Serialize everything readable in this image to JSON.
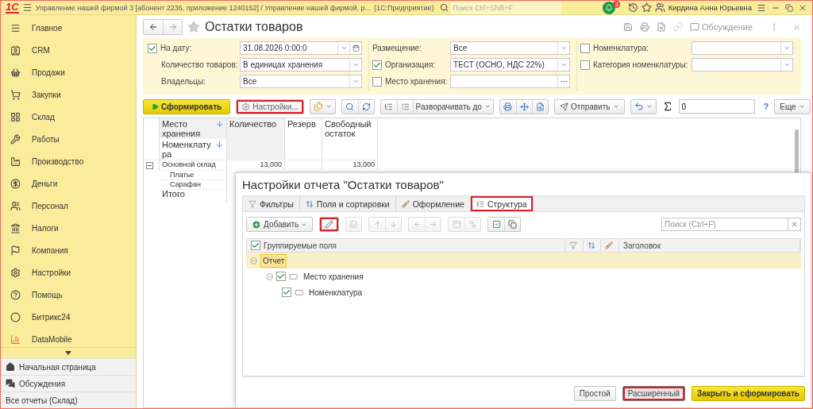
{
  "title_bar": {
    "logo": "1С",
    "title": "Управление нашей фирмой 3 [абонент 2236, приложение 1240152] / Управление нашей фирмой, р...",
    "platform": "(1С:Предприятие)",
    "search": {
      "placeholder": "Поиск Ctrl+Shift+F"
    },
    "notification_count": "3",
    "user": "Кирдина Анна Юрьевна"
  },
  "sidebar": {
    "items": [
      {
        "label": "Главное"
      },
      {
        "label": "CRM"
      },
      {
        "label": "Продажи"
      },
      {
        "label": "Закупки"
      },
      {
        "label": "Склад"
      },
      {
        "label": "Работы"
      },
      {
        "label": "Производство"
      },
      {
        "label": "Деньги"
      },
      {
        "label": "Персонал"
      },
      {
        "label": "Налоги"
      },
      {
        "label": "Компания"
      },
      {
        "label": "Настройки"
      },
      {
        "label": "Помощь"
      },
      {
        "label": "Битрикс24"
      },
      {
        "label": "DataMobile"
      }
    ],
    "footer_items": [
      {
        "label": "Начальная страница"
      },
      {
        "label": "Обсуждения"
      },
      {
        "label": "Все отчеты (Склад)"
      }
    ]
  },
  "form": {
    "title": "Остатки товаров",
    "discussion": "Обсуждение",
    "filter_columns": [
      {
        "fields": [
          {
            "label": "На дату:",
            "checked": true,
            "value": "31.08.2026  0:00:0",
            "kind": "date"
          },
          {
            "label": "Количество товаров:",
            "value": "В единицах хранения",
            "kind": "dropdown"
          },
          {
            "label": "Владельцы:",
            "value": "Все",
            "kind": "dropdown"
          }
        ]
      },
      {
        "fields": [
          {
            "label": "Размещение:",
            "value": "Все",
            "kind": "dropdown"
          },
          {
            "label": "Организация:",
            "checked": true,
            "value": "ТЕСТ (ОСНО, НДС 22%)",
            "kind": "dropdown"
          },
          {
            "label": "Место хранения:",
            "checked": false,
            "kind": "choice"
          }
        ]
      },
      {
        "fields": [
          {
            "label": "Номенклатура:",
            "checked": false,
            "kind": "dropdown"
          },
          {
            "label": "Категория номенклатуры:",
            "checked": false,
            "kind": "dropdown"
          }
        ]
      }
    ],
    "toolbar": {
      "generate": "Сформировать",
      "settings": {
        "label": "Настройки...",
        "highlighted": true
      },
      "expand_to": "Разворачивать до",
      "send": "Отправить",
      "sum_value": "0",
      "help": "?",
      "more": "Еще"
    },
    "report": {
      "group_headings": [
        "Место хранения",
        "Номенклатура"
      ],
      "columns": [
        "Количество",
        "Резерв",
        "Свободный остаток"
      ],
      "rows": [
        {
          "kind": "group",
          "expanded": true,
          "name": "Основной склад",
          "quantity": "13,000",
          "free": "13,000"
        },
        {
          "kind": "item",
          "name": "Платье"
        },
        {
          "kind": "item",
          "name": "Сарафан"
        },
        {
          "kind": "total",
          "name": "Итого"
        }
      ]
    }
  },
  "settings_dialog": {
    "title": "Настройки отчета \"Остатки товаров\"",
    "tabs": [
      {
        "label": "Фильтры",
        "selected": false,
        "highlighted": false
      },
      {
        "label": "Поля и сортировки",
        "selected": false,
        "highlighted": false
      },
      {
        "label": "Оформление",
        "selected": false,
        "highlighted": false
      },
      {
        "label": "Структура",
        "selected": true,
        "highlighted": true
      }
    ],
    "add_button": "Добавить",
    "edit_highlighted": true,
    "search": {
      "placeholder": "Поиск (Ctrl+F)"
    },
    "fields_heading": "Группируемые поля",
    "fields_checked": true,
    "title_heading": "Заголовок",
    "tree": [
      {
        "label": "Отчет",
        "selected": true,
        "expanded": true,
        "children": [
          {
            "label": "Место хранения",
            "checked": true,
            "selected": false,
            "expanded": true,
            "children": [
              {
                "label": "Номенклатура",
                "checked": true,
                "selected": false
              }
            ]
          }
        ]
      }
    ],
    "buttons": [
      {
        "label": "Простой",
        "kind": "plain",
        "selected": false,
        "highlighted": false
      },
      {
        "label": "Расширенный",
        "kind": "plain",
        "selected": true,
        "highlighted": true
      },
      {
        "label": "Закрыть и сформировать",
        "kind": "default",
        "selected": false,
        "highlighted": false
      }
    ]
  }
}
